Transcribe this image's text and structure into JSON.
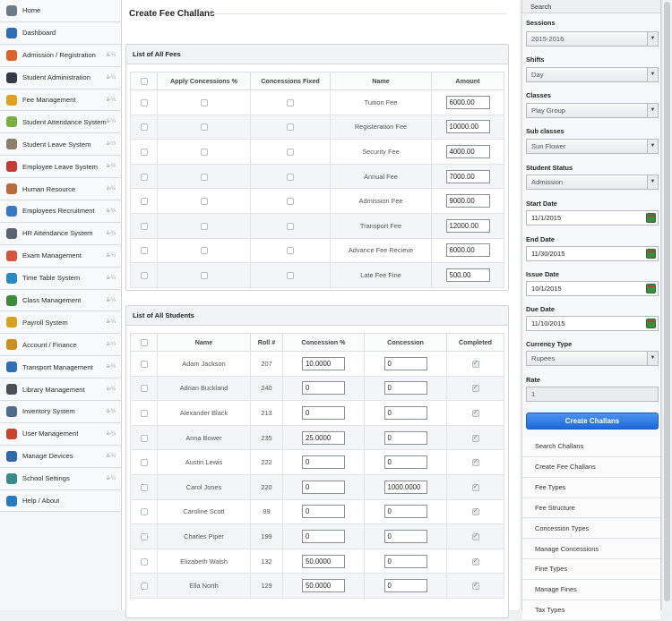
{
  "sidebar": {
    "items": [
      {
        "label": "Home",
        "icon": "home-icon",
        "color": "#6c7a89",
        "chevron": false
      },
      {
        "label": "Dashboard",
        "icon": "globe-icon",
        "color": "#2d6db3",
        "chevron": false
      },
      {
        "label": "Admission / Registration",
        "icon": "user-add-icon",
        "color": "#d9632b",
        "chevron": true
      },
      {
        "label": "Student Administration",
        "icon": "graduation-cap-icon",
        "color": "#333b4a",
        "chevron": true
      },
      {
        "label": "Fee Management",
        "icon": "pencil-icon",
        "color": "#e0a020",
        "chevron": true
      },
      {
        "label": "Student Attendance System",
        "icon": "grid-icon",
        "color": "#7cae44",
        "chevron": true
      },
      {
        "label": "Student Leave System",
        "icon": "document-icon",
        "color": "#8b7e6a",
        "chevron": true
      },
      {
        "label": "Employee Leave System",
        "icon": "calendar-icon",
        "color": "#c43b35",
        "chevron": true
      },
      {
        "label": "Human Resource",
        "icon": "people-icon",
        "color": "#b86a3a",
        "chevron": true
      },
      {
        "label": "Employees Recruitment",
        "icon": "group-icon",
        "color": "#3a78c2",
        "chevron": true
      },
      {
        "label": "HR Attendance System",
        "icon": "clipboard-icon",
        "color": "#5a6470",
        "chevron": true
      },
      {
        "label": "Exam Management",
        "icon": "exam-icon",
        "color": "#d8533b",
        "chevron": true
      },
      {
        "label": "Time Table System",
        "icon": "timetable-icon",
        "color": "#2a8ac4",
        "chevron": true
      },
      {
        "label": "Class Management",
        "icon": "class-icon",
        "color": "#3c8c3c",
        "chevron": true
      },
      {
        "label": "Payroll System",
        "icon": "payroll-icon",
        "color": "#d4a41c",
        "chevron": true
      },
      {
        "label": "Account / Finance",
        "icon": "finance-icon",
        "color": "#c98f20",
        "chevron": true
      },
      {
        "label": "Transport Management",
        "icon": "transport-icon",
        "color": "#2f6fb8",
        "chevron": true
      },
      {
        "label": "Library Management",
        "icon": "library-icon",
        "color": "#4a4f58",
        "chevron": true
      },
      {
        "label": "Inventory System",
        "icon": "inventory-icon",
        "color": "#4f6e8c",
        "chevron": true
      },
      {
        "label": "User Management",
        "icon": "user-icon",
        "color": "#c9452e",
        "chevron": true
      },
      {
        "label": "Manage Devices",
        "icon": "devices-icon",
        "color": "#2e6aa8",
        "chevron": true
      },
      {
        "label": "School Settings",
        "icon": "settings-icon",
        "color": "#3a8a8a",
        "chevron": true
      },
      {
        "label": "Help / About",
        "icon": "help-icon",
        "color": "#2a7ac0",
        "chevron": false
      }
    ],
    "chevron_glyph": "à-¼"
  },
  "main": {
    "title": "Create Fee Challans",
    "fees_panel": {
      "heading": "List of All Fees",
      "headers": [
        "Apply Concessions %",
        "Concessions Fixed",
        "Name",
        "Amount"
      ],
      "rows": [
        {
          "name": "Tuition Fee",
          "amount": "6000.00"
        },
        {
          "name": "Registeration Fee",
          "amount": "10000.00"
        },
        {
          "name": "Security Fee",
          "amount": "4000.00"
        },
        {
          "name": "Annual Fee",
          "amount": "7000.00"
        },
        {
          "name": "Admission Fee",
          "amount": "9000.00"
        },
        {
          "name": "Transport Fee",
          "amount": "12000.00"
        },
        {
          "name": "Advance Fee Recieve",
          "amount": "6000.00"
        },
        {
          "name": "Late Fee Fine",
          "amount": "500.00"
        }
      ]
    },
    "students_panel": {
      "heading": "List of All Students",
      "headers": [
        "Name",
        "Roll #",
        "Concession %",
        "Concession",
        "Completed"
      ],
      "rows": [
        {
          "name": "Adam Jackson",
          "roll": "207",
          "concession_pct": "10.0000",
          "concession": "0",
          "completed": true
        },
        {
          "name": "Adrian Buckland",
          "roll": "240",
          "concession_pct": "0",
          "concession": "0",
          "completed": true
        },
        {
          "name": "Alexander Black",
          "roll": "213",
          "concession_pct": "0",
          "concession": "0",
          "completed": true
        },
        {
          "name": "Anna Bower",
          "roll": "235",
          "concession_pct": "25.0000",
          "concession": "0",
          "completed": true
        },
        {
          "name": "Austin Lewis",
          "roll": "222",
          "concession_pct": "0",
          "concession": "0",
          "completed": true
        },
        {
          "name": "Carol Jones",
          "roll": "220",
          "concession_pct": "0",
          "concession": "1000.0000",
          "completed": true
        },
        {
          "name": "Caroline Scott",
          "roll": "99",
          "concession_pct": "0",
          "concession": "0",
          "completed": true
        },
        {
          "name": "Charles Piper",
          "roll": "199",
          "concession_pct": "0",
          "concession": "0",
          "completed": true
        },
        {
          "name": "Elizabeth Walsh",
          "roll": "132",
          "concession_pct": "50.0000",
          "concession": "0",
          "completed": true
        },
        {
          "name": "Ella North",
          "roll": "129",
          "concession_pct": "50.0000",
          "concession": "0",
          "completed": true
        }
      ]
    }
  },
  "search": {
    "heading": "Search",
    "sessions": {
      "label": "Sessions",
      "value": "2015-2016"
    },
    "shifts": {
      "label": "Shifts",
      "value": "Day"
    },
    "classes": {
      "label": "Classes",
      "value": "Play Group"
    },
    "sub_classes": {
      "label": "Sub classes",
      "value": "Sun Flower"
    },
    "student_status": {
      "label": "Student Status",
      "value": "Admission"
    },
    "start_date": {
      "label": "Start Date",
      "value": "11/1/2015"
    },
    "end_date": {
      "label": "End Date",
      "value": "11/30/2015"
    },
    "issue_date": {
      "label": "Issue Date",
      "value": "10/1/2015"
    },
    "due_date": {
      "label": "Due Date",
      "value": "11/10/2015"
    },
    "currency_type": {
      "label": "Currency Type",
      "value": "Rupees"
    },
    "rate": {
      "label": "Rate",
      "value": "1"
    },
    "create_button": "Create Challans",
    "links": [
      "Search Challans",
      "Create Fee Challans",
      "Fee Types",
      "Fee Structure",
      "Concession Types",
      "Manage Concessions",
      "Fine Types",
      "Manage Fines",
      "Tax Types"
    ]
  },
  "colors": {
    "accent": "#2a74e0",
    "panel_border": "#cfd3d6"
  }
}
